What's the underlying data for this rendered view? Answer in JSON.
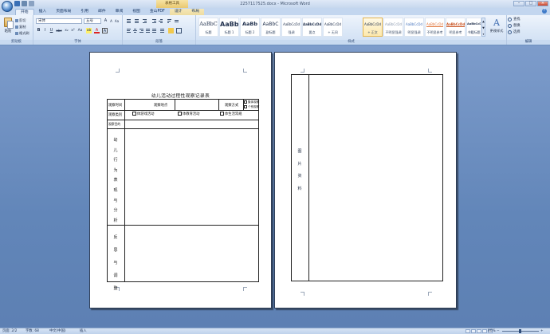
{
  "window": {
    "title": "2257117525.docx - Microsoft Word",
    "context_tab_title": "表格工具",
    "min": "–",
    "max": "□",
    "close": "×"
  },
  "tabs": [
    "开始",
    "插入",
    "页面布局",
    "引用",
    "邮件",
    "审阅",
    "视图",
    "金山PDF",
    "设计",
    "布局"
  ],
  "ribbon": {
    "clipboard": {
      "paste": "粘贴",
      "cut": "剪切",
      "copy": "复制",
      "format_painter": "格式刷",
      "label": "剪贴板"
    },
    "font": {
      "font_name": "宋体",
      "font_size": "五号",
      "grow": "A",
      "shrink": "A",
      "clear": "Aa",
      "bold": "B",
      "italic": "I",
      "underline": "U",
      "strike": "abc",
      "sub": "x₂",
      "sup": "x²",
      "case": "Aa",
      "highlight": "ab",
      "color": "A",
      "border_char": "A",
      "label": "字体"
    },
    "paragraph": {
      "label": "段落"
    },
    "styles": {
      "items": [
        {
          "sample": "AaBbC",
          "name": "标题"
        },
        {
          "sample": "AaBb",
          "name": "标题 1"
        },
        {
          "sample": "AaBb",
          "name": "标题 2"
        },
        {
          "sample": "AaBbC",
          "name": "副标题"
        },
        {
          "sample": "AaBbCcDd",
          "name": "强调"
        },
        {
          "sample": "AaBbCcDd",
          "name": "要点"
        },
        {
          "sample": "AaBbCcDd",
          "name": "+ 无间"
        },
        {
          "sample": "AaBbCcDd",
          "name": "+ 正文"
        },
        {
          "sample": "AaBbCcDd",
          "name": "不明显强调"
        },
        {
          "sample": "AaBbCcDd",
          "name": "明显强调"
        },
        {
          "sample": "AaBbCcDd",
          "name": "不明显参考"
        },
        {
          "sample": "AaBbCcDd",
          "name": "明显参考"
        },
        {
          "sample": "AaBbCcDd",
          "name": "书籍标题"
        }
      ],
      "label": "样式",
      "change_styles": "更改样式"
    },
    "editing": {
      "find": "查找",
      "replace": "替换",
      "select": "选择",
      "label": "编辑"
    }
  },
  "document": {
    "left_page": {
      "title": "幼儿活动过程性观察记录表",
      "row1": {
        "time": "观察时间",
        "place": "观察地点",
        "method": "观察方式",
        "method_opt1": "集体观察",
        "method_opt2": "个别观察"
      },
      "row2": {
        "type": "观察类别",
        "opt1": "体游戏活动",
        "opt2": "体教育活动",
        "opt3": "体生活常规"
      },
      "row3": {
        "target": "观察目的"
      },
      "analysis_chars": [
        "幼",
        "儿",
        "行",
        "为",
        "表",
        "现",
        "与",
        "分",
        "析"
      ],
      "reflection_chars": [
        "反",
        "思",
        "与",
        "调",
        "整"
      ]
    },
    "right_page": {
      "side_chars": [
        "图",
        "片",
        "资",
        "料"
      ]
    }
  },
  "statusbar": {
    "page": "页面: 2/2",
    "words": "字数: 68",
    "language": "中文(中国)",
    "insert": "插入",
    "zoom": "80%",
    "zoom_minus": "−",
    "zoom_plus": "+"
  }
}
